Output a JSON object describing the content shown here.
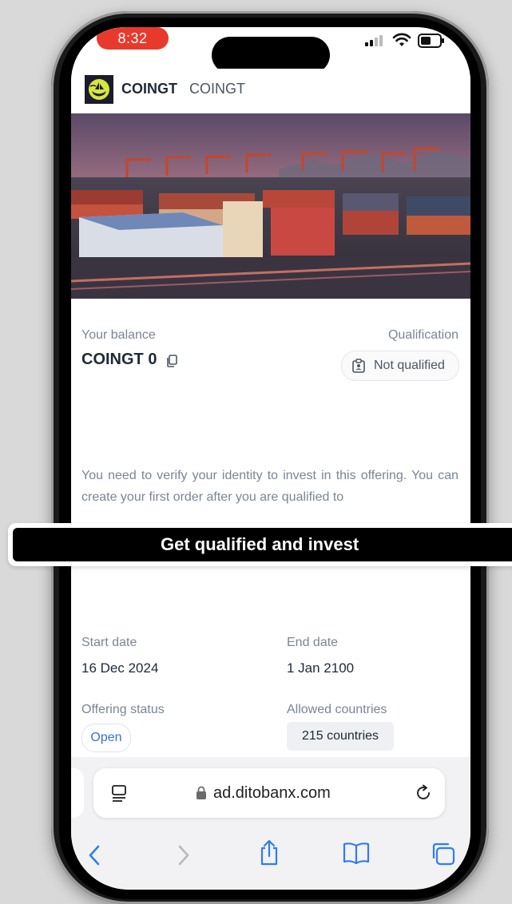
{
  "status_bar": {
    "time": "8:32"
  },
  "header": {
    "brand": "COINGT",
    "brand_sub": "COINGT"
  },
  "balance": {
    "label": "Your balance",
    "value": "COINGT 0"
  },
  "qualification": {
    "label": "Qualification",
    "status": "Not qualified"
  },
  "notice": "You need to verify your identity to invest in this offering. You can create your first order after you are qualified to",
  "cta": {
    "label": "Get qualified and invest"
  },
  "dates": {
    "start_label": "Start date",
    "start_value": "16 Dec 2024",
    "end_label": "End date",
    "end_value": "1 Jan 2100"
  },
  "offering": {
    "status_label": "Offering status",
    "status_value": "Open",
    "countries_label": "Allowed countries",
    "countries_value": "215 countries"
  },
  "browser": {
    "url": "ad.ditobanx.com"
  },
  "colors": {
    "accent_blue": "#3b6fd8",
    "time_pill": "#e8392d",
    "safari_blue": "#2f7cf6"
  }
}
